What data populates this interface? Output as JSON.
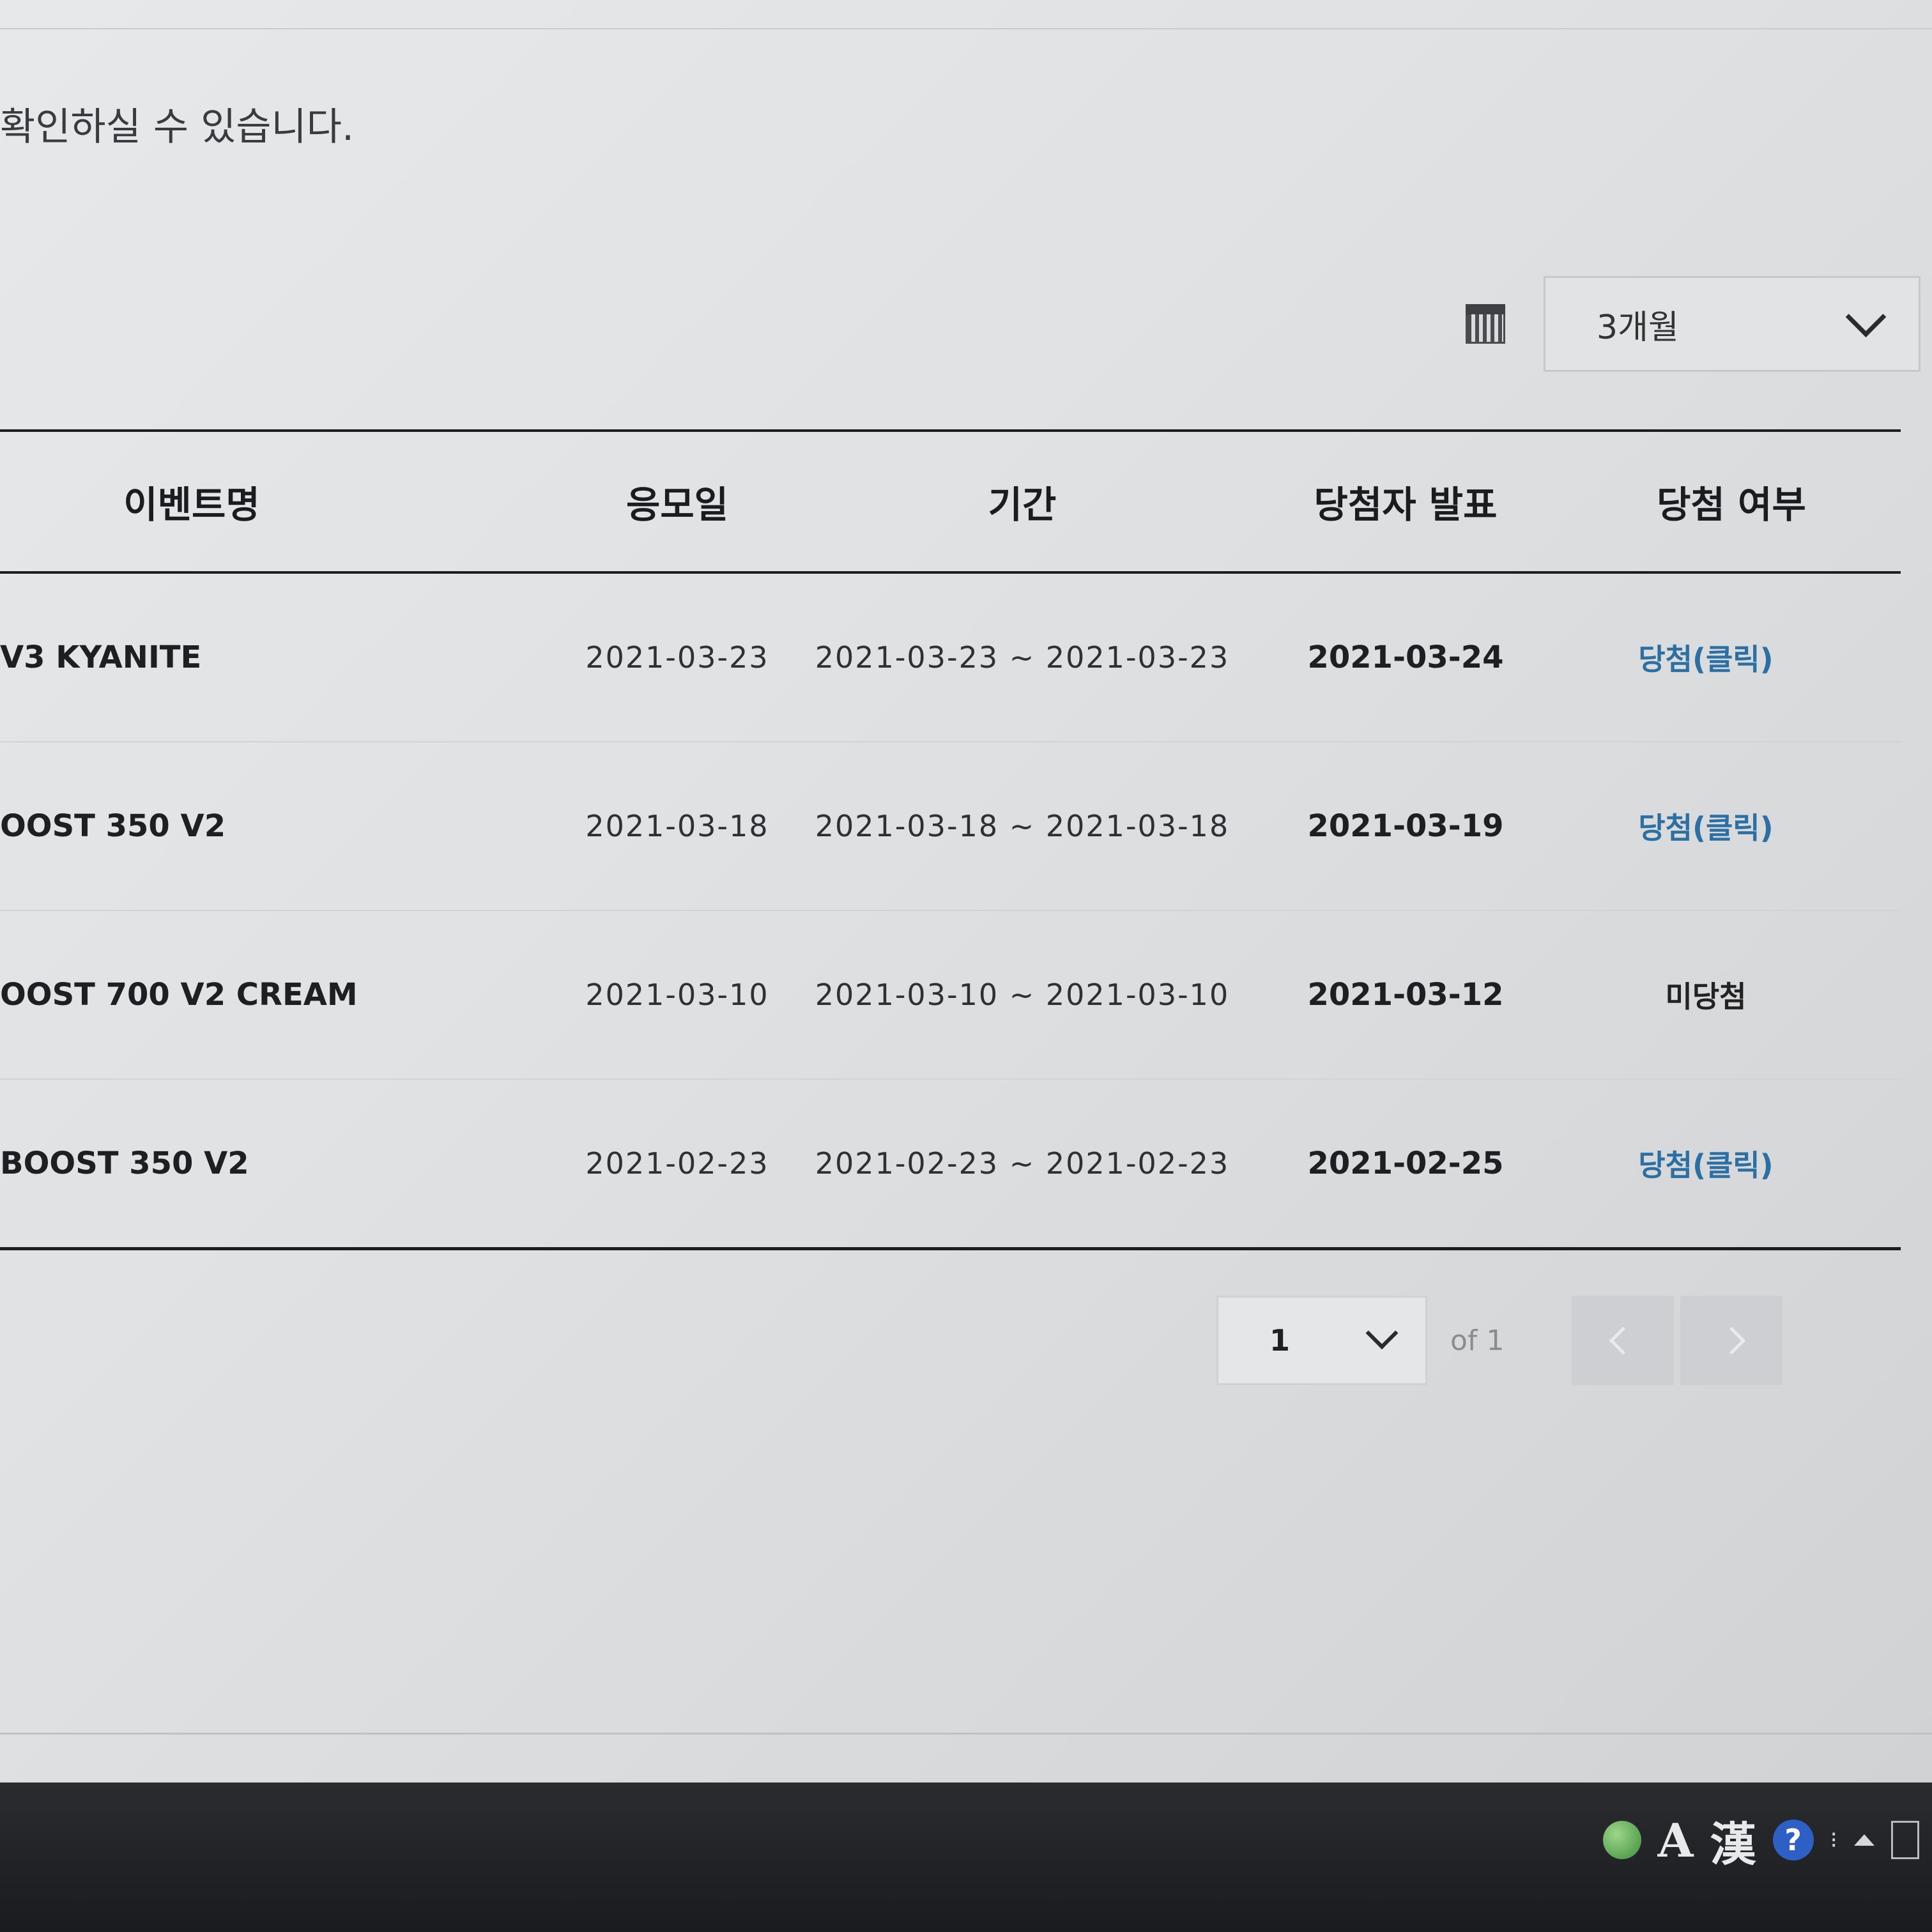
{
  "notice_text": "확인하실 수 있습니다.",
  "filter": {
    "calendar_icon": "calendar-icon",
    "period_value": "3개월"
  },
  "table": {
    "headers": {
      "event_name": "이벤트명",
      "apply_date": "응모일",
      "period": "기간",
      "announce": "당첨자 발표",
      "result": "당첨 여부"
    },
    "rows": [
      {
        "event_name": "V3 KYANITE",
        "apply_date": "2021-03-23",
        "period": "2021-03-23 ~ 2021-03-23",
        "announce": "2021-03-24",
        "result": "당첨(클릭)"
      },
      {
        "event_name": "OOST 350 V2",
        "apply_date": "2021-03-18",
        "period": "2021-03-18 ~ 2021-03-18",
        "announce": "2021-03-19",
        "result": "당첨(클릭)"
      },
      {
        "event_name": "OOST 700 V2 CREAM",
        "apply_date": "2021-03-10",
        "period": "2021-03-10 ~ 2021-03-10",
        "announce": "2021-03-12",
        "result": "미당첨"
      },
      {
        "event_name": "BOOST 350 V2",
        "apply_date": "2021-02-23",
        "period": "2021-02-23 ~ 2021-02-23",
        "announce": "2021-02-25",
        "result": "당첨(클릭)"
      }
    ]
  },
  "pagination": {
    "current_page": "1",
    "total_label": "of 1",
    "prev_icon": "chevron-left-icon",
    "next_icon": "chevron-right-icon"
  },
  "taskbar": {
    "lang_a": "A",
    "lang_han": "漢",
    "help": "?"
  },
  "colors": {
    "win_link": "#2b6fa3",
    "rule": "#1c1d20"
  }
}
